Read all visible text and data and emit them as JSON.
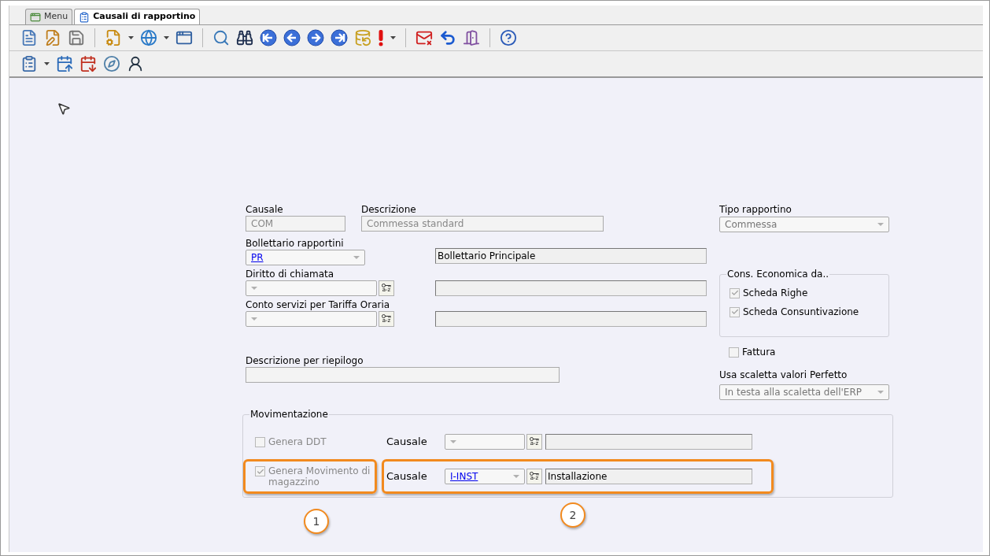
{
  "tabs": [
    {
      "label": "Menu",
      "selected": false
    },
    {
      "label": "Causali di rapportino",
      "selected": true
    }
  ],
  "form": {
    "causale": {
      "label": "Causale",
      "value": "COM"
    },
    "descrizione": {
      "label": "Descrizione",
      "value": "Commessa standard"
    },
    "tipo_rapportino": {
      "label": "Tipo rapportino",
      "value": "Commessa"
    },
    "bollettario": {
      "label": "Bollettario rapportini",
      "value": "PR",
      "description": "Bollettario Principale"
    },
    "diritto": {
      "label": "Diritto di chiamata",
      "lookup": "a-z"
    },
    "conto_servizi": {
      "label": "Conto servizi per Tariffa Oraria",
      "lookup": "a-z"
    },
    "cons_economica": {
      "title": "Cons. Economica da..",
      "options": [
        {
          "label": "Scheda Righe",
          "checked": true
        },
        {
          "label": "Scheda Consuntivazione",
          "checked": true
        }
      ]
    },
    "fattura": {
      "label": "Fattura",
      "checked": false
    },
    "descrizione_riepilogo": {
      "label": "Descrizione per riepilogo"
    },
    "usa_scaletta": {
      "label": "Usa scaletta valori Perfetto",
      "value": "In testa alla scaletta dell'ERP"
    },
    "movimentazione": {
      "title": "Movimentazione",
      "rows": [
        {
          "label": "Genera DDT",
          "checked": false,
          "causale_label": "Causale",
          "lookup": "a-z",
          "highlighted": false
        },
        {
          "label": "Genera Movimento di magazzino",
          "checked": true,
          "causale_label": "Causale",
          "value": "I-INST",
          "description": "Installazione",
          "lookup": "a-z",
          "highlighted": true
        }
      ]
    }
  },
  "callouts": [
    "1",
    "2"
  ]
}
